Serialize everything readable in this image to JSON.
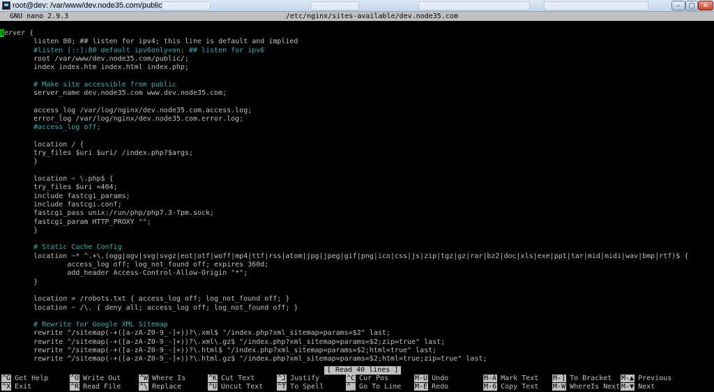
{
  "window": {
    "title": "root@dev: /var/www/dev.node35.com/public",
    "min_glyph": "–",
    "max_glyph": "□",
    "close_glyph": "✕"
  },
  "nano": {
    "version": "GNU nano 2.9.3",
    "file_path": "/etc/nginx/sites-available/dev.node35.com",
    "status": "[ Read 40 lines ]"
  },
  "editor": {
    "cursor_char": "s",
    "lines": [
      {
        "text": "erver {",
        "comment": false
      },
      {
        "text": "        listen 80; ## listen for ipv4; this line is default and implied",
        "comment": false
      },
      {
        "text": "        #listen [::]:80 default ipv6only=on; ## listen for ipv6",
        "comment": true
      },
      {
        "text": "        root /var/www/dev.node35.com/public/;",
        "comment": false
      },
      {
        "text": "        index index.htm index.html index.php;",
        "comment": false
      },
      {
        "text": "",
        "comment": false
      },
      {
        "text": "        # Make site accessible from public",
        "comment": true
      },
      {
        "text": "        server_name dev.node35.com www.dev.node35.com;",
        "comment": false
      },
      {
        "text": "",
        "comment": false
      },
      {
        "text": "        access_log /var/log/nginx/dev.node35.com.access.log;",
        "comment": false
      },
      {
        "text": "        error_log /var/log/nginx/dev.node35.com.error.log;",
        "comment": false
      },
      {
        "text": "        #access_log off;",
        "comment": true
      },
      {
        "text": "",
        "comment": false
      },
      {
        "text": "        location / {",
        "comment": false
      },
      {
        "text": "        try_files $uri $uri/ /index.php?$args;",
        "comment": false
      },
      {
        "text": "        }",
        "comment": false
      },
      {
        "text": "",
        "comment": false
      },
      {
        "text": "        location ~ \\.php$ {",
        "comment": false
      },
      {
        "text": "        try_files $uri =404;",
        "comment": false
      },
      {
        "text": "        include fastcgi_params;",
        "comment": false
      },
      {
        "text": "        include fastcgi.conf;",
        "comment": false
      },
      {
        "text": "        fastcgi_pass unix:/run/php/php7.3-fpm.sock;",
        "comment": false
      },
      {
        "text": "        fastcgi_param HTTP_PROXY \"\";",
        "comment": false
      },
      {
        "text": "        }",
        "comment": false
      },
      {
        "text": "",
        "comment": false
      },
      {
        "text": "        # Static Cache Config",
        "comment": true
      },
      {
        "text": "        location ~* ^.+\\.(ogg|ogv|svg|svgz|eot|otf|woff|mp4|ttf|rss|atom|jpg|jpeg|gif|png|ico|css|js|zip|tgz|gz|rar|bz2|doc|xls|exe|ppt|tar|mid|midi|wav|bmp|rtf)$ {",
        "comment": false
      },
      {
        "text": "                access_log off; log_not_found off; expires 360d;",
        "comment": false
      },
      {
        "text": "                add_header Access-Control-Allow-Origin \"*\";",
        "comment": false
      },
      {
        "text": "        }",
        "comment": false
      },
      {
        "text": "",
        "comment": false
      },
      {
        "text": "        location = /robots.txt { access_log off; log_not_found off; }",
        "comment": false
      },
      {
        "text": "        location ~ /\\. { deny all; access_log off; log_not_found off; }",
        "comment": false
      },
      {
        "text": "",
        "comment": false
      },
      {
        "text": "        # Rewrite for Google XML Sitemap",
        "comment": true
      },
      {
        "text": "        rewrite ^/sitemap(-+([a-zA-Z0-9_-]+))?\\.xml$ \"/index.php?xml_sitemap=params=$2\" last;",
        "comment": false
      },
      {
        "text": "        rewrite ^/sitemap(-+([a-zA-Z0-9_-]+))?\\.xml\\.gz$ \"/index.php?xml_sitemap=params=$2;zip=true\" last;",
        "comment": false
      },
      {
        "text": "        rewrite ^/sitemap(-+([a-zA-Z0-9_-]+))?\\.html$ \"/index.php?xml_sitemap=params=$2;html=true\" last;",
        "comment": false
      },
      {
        "text": "        rewrite ^/sitemap(-+([a-zA-Z0-9_-]+))?\\.html.gz$ \"/index.php?xml_sitemap=params=$2;html=true;zip=true\" last;",
        "comment": false
      }
    ]
  },
  "shortcuts": [
    {
      "key": "^G",
      "label": "Get Help",
      "name": "get-help"
    },
    {
      "key": "^O",
      "label": "Write Out",
      "name": "write-out"
    },
    {
      "key": "^W",
      "label": "Where Is",
      "name": "where-is"
    },
    {
      "key": "^K",
      "label": "Cut Text",
      "name": "cut-text"
    },
    {
      "key": "^J",
      "label": "Justify",
      "name": "justify"
    },
    {
      "key": "^C",
      "label": "Cur Pos",
      "name": "cur-pos"
    },
    {
      "key": "M-U",
      "label": "Undo",
      "name": "undo"
    },
    {
      "key": "M-A",
      "label": "Mark Text",
      "name": "mark-text"
    },
    {
      "key": "M-]",
      "label": "To Bracket",
      "name": "to-bracket"
    },
    {
      "key": "M-▲",
      "label": "Previous",
      "name": "previous"
    },
    {
      "key": "^X",
      "label": "Exit",
      "name": "exit"
    },
    {
      "key": "^R",
      "label": "Read File",
      "name": "read-file"
    },
    {
      "key": "^\\",
      "label": "Replace",
      "name": "replace"
    },
    {
      "key": "^U",
      "label": "Uncut Text",
      "name": "uncut-text"
    },
    {
      "key": "^T",
      "label": "To Spell",
      "name": "to-spell"
    },
    {
      "key": "^_",
      "label": "Go To Line",
      "name": "go-to-line"
    },
    {
      "key": "M-E",
      "label": "Redo",
      "name": "redo"
    },
    {
      "key": "M-6",
      "label": "Copy Text",
      "name": "copy-text"
    },
    {
      "key": "M-W",
      "label": "WhereIs Next",
      "name": "whereis-next"
    },
    {
      "key": "M-▼",
      "label": "Next",
      "name": "next"
    }
  ]
}
